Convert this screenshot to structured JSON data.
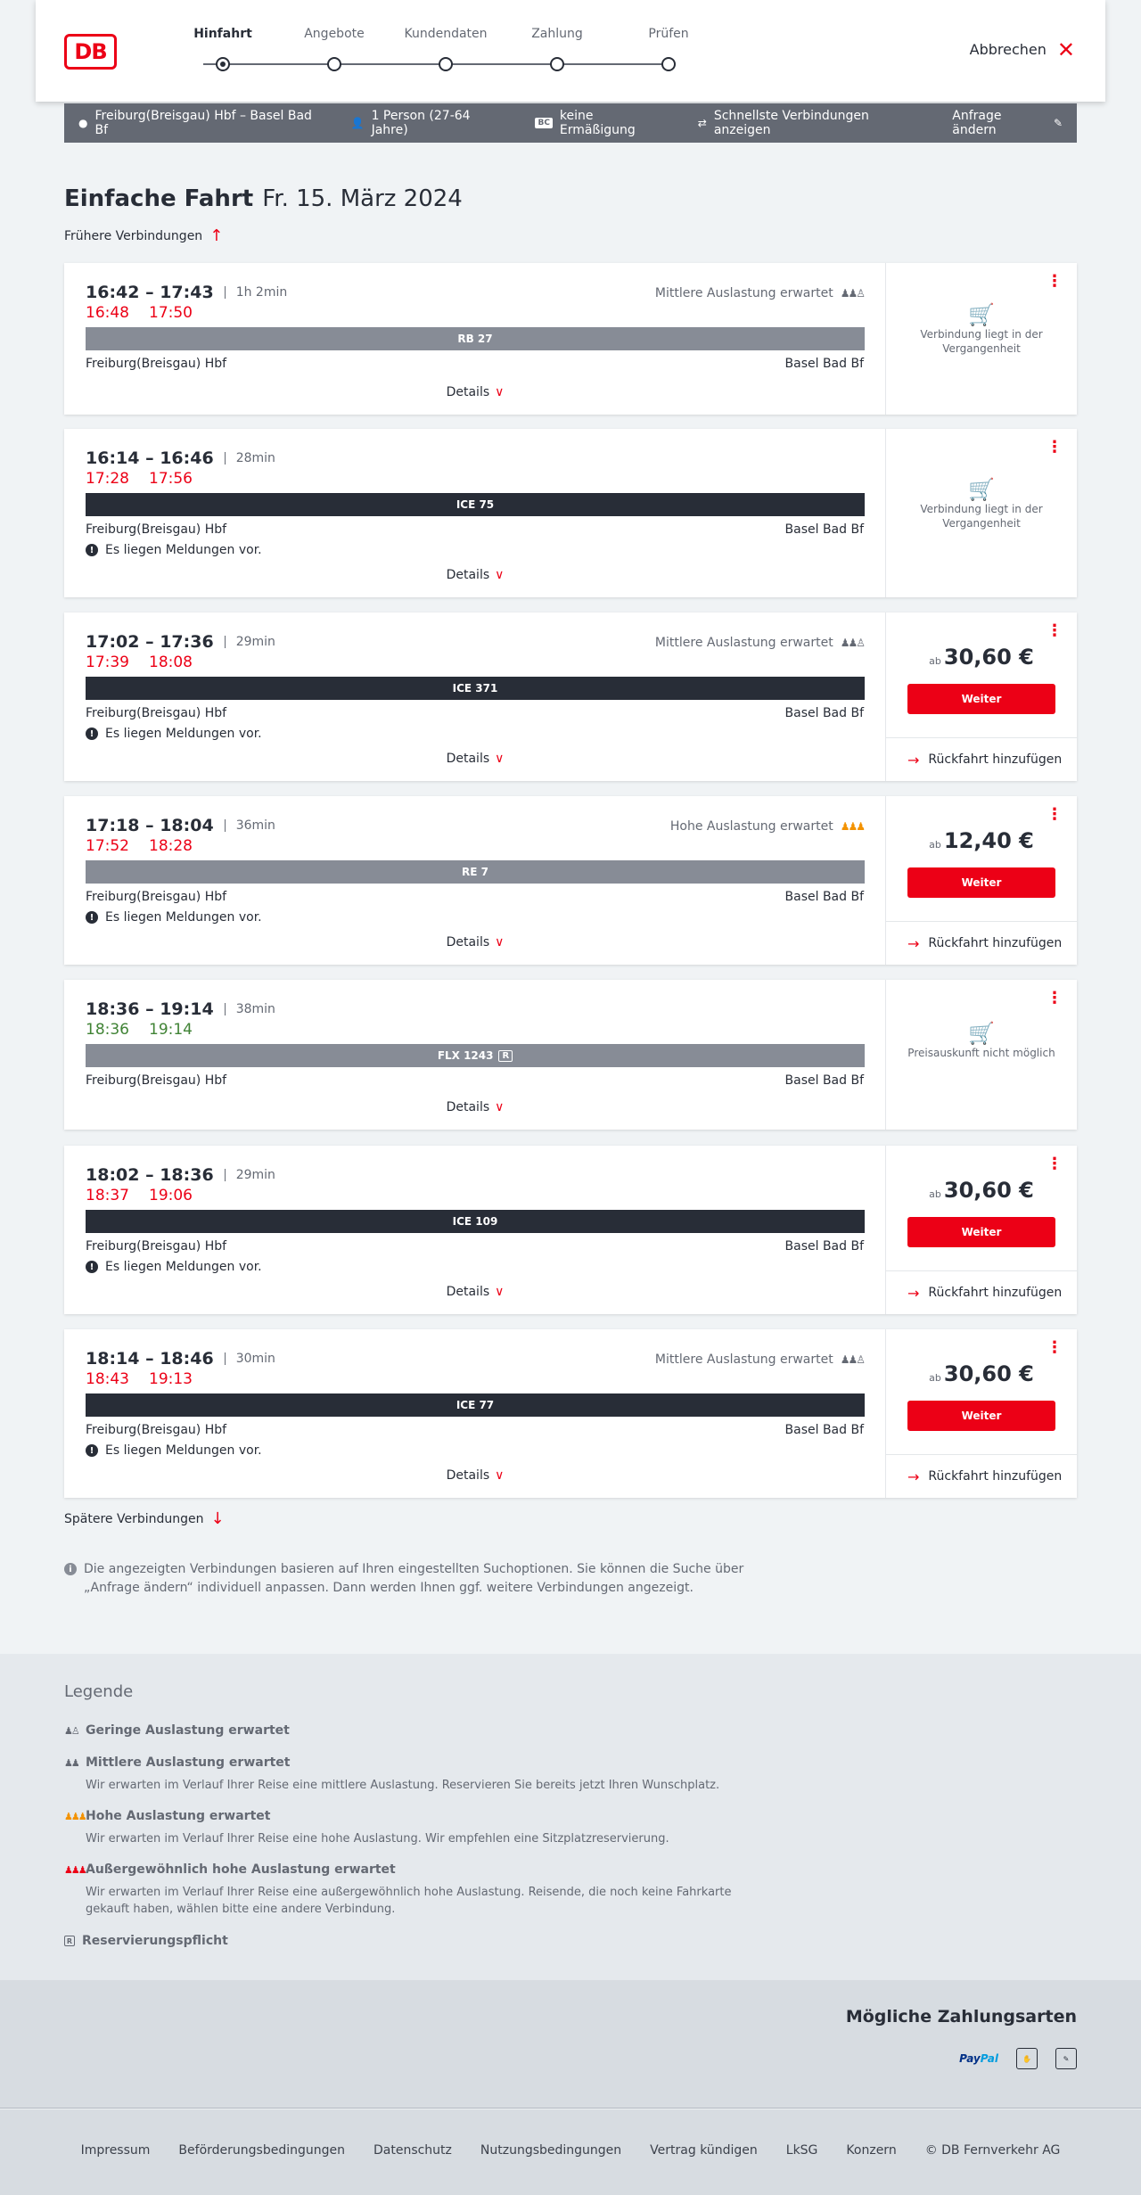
{
  "header": {
    "logo_text": "DB",
    "steps": [
      "Hinfahrt",
      "Angebote",
      "Kundendaten",
      "Zahlung",
      "Prüfen"
    ],
    "active_step": 0,
    "cancel_label": "Abbrechen"
  },
  "summary": {
    "route": "Freiburg(Breisgau) Hbf – Basel Bad Bf",
    "passengers": "1 Person (27-64 Jahre)",
    "discount_badge": "BC",
    "discount": "keine Ermäßigung",
    "fastest": "Schnellste Verbindungen anzeigen",
    "edit": "Anfrage ändern"
  },
  "title": {
    "main": "Einfache Fahrt",
    "date": "Fr. 15. März 2024"
  },
  "earlier_label": "Frühere Verbindungen",
  "later_label": "Spätere Verbindungen",
  "common": {
    "from": "Freiburg(Breisgau) Hbf",
    "to": "Basel Bad Bf",
    "details": "Details",
    "message": "Es liegen Meldungen vor.",
    "price_prefix": "ab",
    "weiter": "Weiter",
    "return": "Rückfahrt hinzufügen",
    "past": "Verbindung liegt in der Vergangenheit",
    "no_price": "Preisauskunft nicht möglich"
  },
  "connections": [
    {
      "times": "16:42 – 17:43",
      "duration": "1h 2min",
      "rt_dep": "16:48",
      "rt_arr": "17:50",
      "train": "RB 27",
      "occupancy": "Mittlere Auslastung erwartet"
    },
    {
      "times": "16:14 – 16:46",
      "duration": "28min",
      "rt_dep": "17:28",
      "rt_arr": "17:56",
      "train": "ICE 75"
    },
    {
      "times": "17:02 – 17:36",
      "duration": "29min",
      "rt_dep": "17:39",
      "rt_arr": "18:08",
      "train": "ICE 371",
      "occupancy": "Mittlere Auslastung erwartet",
      "price": "30,60 €"
    },
    {
      "times": "17:18 – 18:04",
      "duration": "36min",
      "rt_dep": "17:52",
      "rt_arr": "18:28",
      "train": "RE 7",
      "occupancy": "Hohe Auslastung erwartet",
      "price": "12,40 €"
    },
    {
      "times": "18:36 – 19:14",
      "duration": "38min",
      "rt_dep": "18:36",
      "rt_arr": "19:14",
      "train": "FLX 1243",
      "train_badge": "R"
    },
    {
      "times": "18:02 – 18:36",
      "duration": "29min",
      "rt_dep": "18:37",
      "rt_arr": "19:06",
      "train": "ICE 109",
      "price": "30,60 €"
    },
    {
      "times": "18:14 – 18:46",
      "duration": "30min",
      "rt_dep": "18:43",
      "rt_arr": "19:13",
      "train": "ICE 77",
      "occupancy": "Mittlere Auslastung erwartet",
      "price": "30,60 €"
    }
  ],
  "info_note": "Die angezeigten Verbindungen basieren auf Ihren eingestellten Suchoptionen. Sie können die Suche über „Anfrage ändern“ individuell anpassen. Dann werden Ihnen ggf. weitere Verbindungen angezeigt.",
  "legend": {
    "title": "Legende",
    "items": [
      {
        "title": "Geringe Auslastung erwartet",
        "desc": ""
      },
      {
        "title": "Mittlere Auslastung erwartet",
        "desc": "Wir erwarten im Verlauf Ihrer Reise eine mittlere Auslastung. Reservieren Sie bereits jetzt Ihren Wunschplatz."
      },
      {
        "title": "Hohe Auslastung erwartet",
        "desc": "Wir erwarten im Verlauf Ihrer Reise eine hohe Auslastung. Wir empfehlen eine Sitzplatzreservierung."
      },
      {
        "title": "Außergewöhnlich hohe Auslastung erwartet",
        "desc": "Wir erwarten im Verlauf Ihrer Reise eine außergewöhnlich hohe Auslastung. Reisende, die noch keine Fahrkarte gekauft haben, wählen bitte eine andere Verbindung."
      },
      {
        "title": "Reservierungspflicht",
        "desc": ""
      }
    ]
  },
  "payments": {
    "title": "Mögliche Zahlungsarten",
    "paypal_a": "Pay",
    "paypal_b": "Pal"
  },
  "footer": {
    "links": [
      "Impressum",
      "Beförderungsbedingungen",
      "Datenschutz",
      "Nutzungsbedingungen",
      "Vertrag kündigen",
      "LkSG",
      "Konzern",
      "© DB Fernverkehr AG"
    ]
  },
  "colors": {
    "brand_red": "#ec0016",
    "delay_red": "#ec0016",
    "ontime_green": "#408335",
    "dark": "#282d37",
    "gray_bar": "#878c96",
    "orange": "#f39200"
  }
}
